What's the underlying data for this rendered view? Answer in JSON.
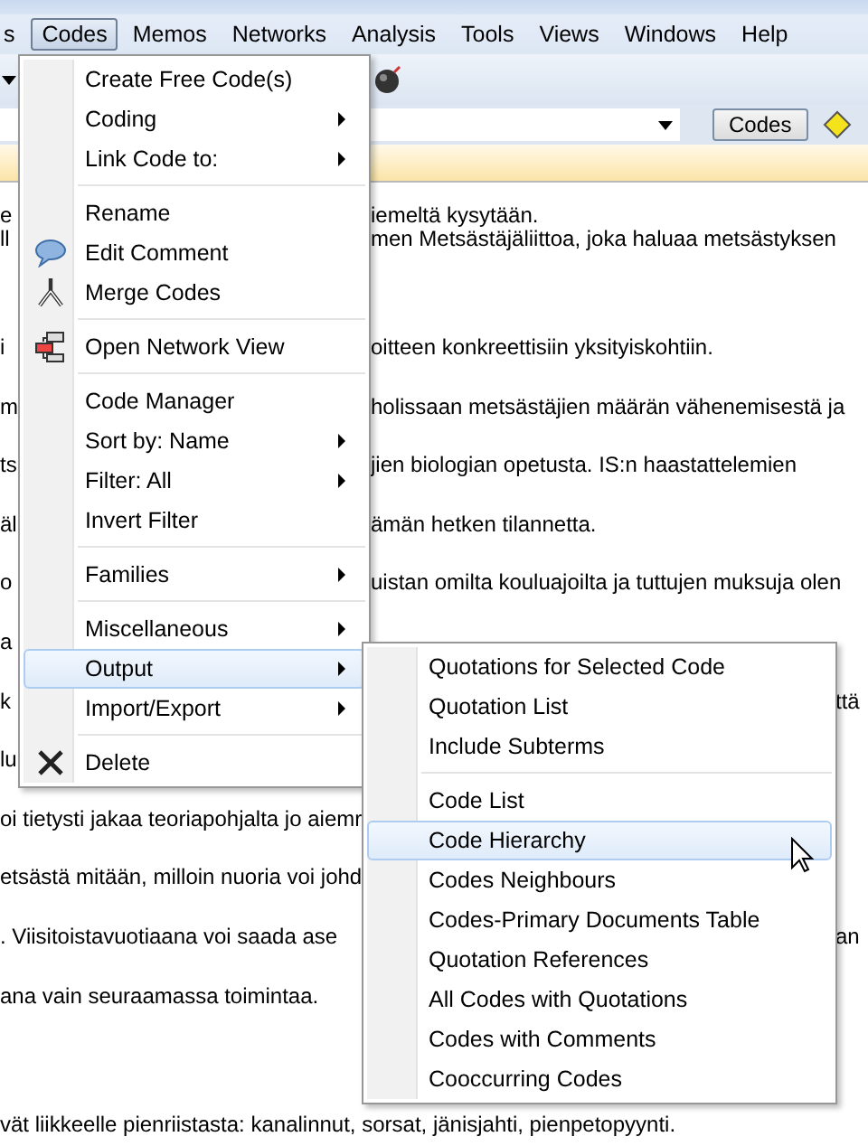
{
  "menu_bar": [
    {
      "label": "s",
      "selected": false
    },
    {
      "label": "Codes",
      "selected": true
    },
    {
      "label": "Memos",
      "selected": false
    },
    {
      "label": "Networks",
      "selected": false
    },
    {
      "label": "Analysis",
      "selected": false
    },
    {
      "label": "Tools",
      "selected": false
    },
    {
      "label": "Views",
      "selected": false
    },
    {
      "label": "Windows",
      "selected": false
    },
    {
      "label": "Help",
      "selected": false
    }
  ],
  "code_bar": {
    "button": "Codes"
  },
  "document": {
    "lines": [
      {
        "left": "e",
        "right": "iemeltä kysytään."
      },
      {
        "left": "ll",
        "right": "men Metsästäjäliittoa, joka haluaa metsästyksen"
      },
      {
        "left": "i",
        "right": "oitteen konkreettisiin yksityiskohtiin."
      },
      {
        "left": "m",
        "right": "holissaan metsästäjien määrän vähenemisestä ja"
      },
      {
        "left": "ts",
        "right": "jien biologian opetusta. IS:n haastattelemien"
      },
      {
        "left": "äl",
        "right": "ämän hetken tilannetta."
      },
      {
        "left": "o",
        "right": "uistan omilta kouluajoilta ja tuttujen muksuja olen"
      },
      {
        "left": "a"
      },
      {
        "left": "k",
        "far_right": "ttä"
      },
      {
        "left": "lu"
      },
      {
        "left": "oi tietysti jakaa teoriapohjalta jo aiemr"
      },
      {
        "left": "etsästä mitään, milloin nuoria voi johd"
      },
      {
        "left": ". Viisitoistavuotiaana voi saada ase",
        "far_right": "an"
      },
      {
        "left": "ana vain seuraamassa toimintaa."
      },
      {
        "left": "vät liikkeelle pienriistasta: kanalinnut, sorsat, jänisjahti, pienpetopyynti."
      }
    ]
  },
  "codes_menu": {
    "items": [
      {
        "kind": "plain",
        "label": "Create Free Code(s)",
        "submenu": false,
        "selected": false
      },
      {
        "kind": "plain",
        "label": "Coding",
        "submenu": true,
        "selected": false
      },
      {
        "kind": "plain",
        "label": "Link Code to:",
        "submenu": true,
        "selected": false
      },
      {
        "kind": "separator"
      },
      {
        "kind": "plain",
        "label": "Rename",
        "submenu": false,
        "selected": false
      },
      {
        "kind": "comment",
        "label": "Edit Comment",
        "submenu": false,
        "selected": false
      },
      {
        "kind": "merge",
        "label": "Merge Codes",
        "submenu": false,
        "selected": false
      },
      {
        "kind": "separator"
      },
      {
        "kind": "network",
        "label": "Open Network View",
        "submenu": false,
        "selected": false
      },
      {
        "kind": "separator"
      },
      {
        "kind": "plain",
        "label": "Code Manager",
        "submenu": false,
        "selected": false
      },
      {
        "kind": "plain",
        "label": "Sort by: Name",
        "submenu": true,
        "selected": false
      },
      {
        "kind": "plain",
        "label": "Filter: All",
        "submenu": true,
        "selected": false
      },
      {
        "kind": "plain",
        "label": "Invert Filter",
        "submenu": false,
        "selected": false
      },
      {
        "kind": "separator"
      },
      {
        "kind": "plain",
        "label": "Families",
        "submenu": true,
        "selected": false
      },
      {
        "kind": "separator"
      },
      {
        "kind": "plain",
        "label": "Miscellaneous",
        "submenu": true,
        "selected": false
      },
      {
        "kind": "plain",
        "label": "Output",
        "submenu": true,
        "selected": true
      },
      {
        "kind": "plain",
        "label": "Import/Export",
        "submenu": true,
        "selected": false
      },
      {
        "kind": "separator"
      },
      {
        "kind": "delete",
        "label": "Delete",
        "submenu": false,
        "selected": false
      }
    ]
  },
  "output_menu": {
    "items": [
      {
        "kind": "plain",
        "label": "Quotations for Selected Code",
        "submenu": false,
        "selected": false
      },
      {
        "kind": "plain",
        "label": "Quotation List",
        "submenu": false,
        "selected": false
      },
      {
        "kind": "plain",
        "label": "Include Subterms",
        "submenu": false,
        "selected": false
      },
      {
        "kind": "separator"
      },
      {
        "kind": "plain",
        "label": "Code List",
        "submenu": false,
        "selected": false
      },
      {
        "kind": "plain",
        "label": "Code Hierarchy",
        "submenu": false,
        "selected": true
      },
      {
        "kind": "plain",
        "label": "Codes Neighbours",
        "submenu": false,
        "selected": false
      },
      {
        "kind": "plain",
        "label": "Codes-Primary Documents Table",
        "submenu": false,
        "selected": false
      },
      {
        "kind": "plain",
        "label": "Quotation References",
        "submenu": false,
        "selected": false
      },
      {
        "kind": "plain",
        "label": "All Codes with Quotations",
        "submenu": false,
        "selected": false
      },
      {
        "kind": "plain",
        "label": "Codes with Comments",
        "submenu": false,
        "selected": false
      },
      {
        "kind": "plain",
        "label": "Cooccurring Codes",
        "submenu": false,
        "selected": false
      }
    ]
  }
}
